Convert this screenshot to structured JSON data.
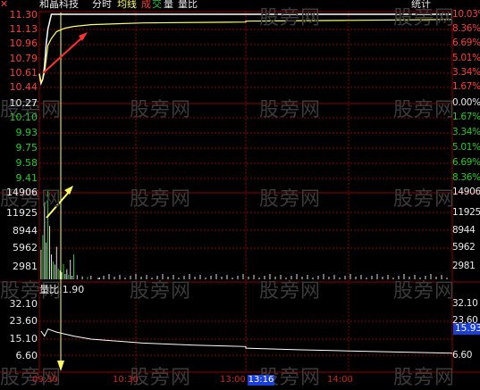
{
  "header": {
    "stock_name": "和晶科技",
    "tab_minute": "分时",
    "legend_avg": "均线",
    "legend_red": "成",
    "legend_green": "交",
    "legend_volume": "量",
    "legend_vol_ratio": "量比",
    "stats_button": "统计"
  },
  "price_axis": {
    "left_labels": [
      "11.30",
      "11.13",
      "10.96",
      "10.79",
      "10.61",
      "10.44",
      "10.27",
      "10.10",
      "9.93",
      "9.75",
      "9.58",
      "9.41"
    ],
    "right_labels": [
      "10.03%",
      "8.36%",
      "6.69%",
      "5.01%",
      "3.34%",
      "1.67%",
      "0.00%",
      "1.67%",
      "3.34%",
      "5.01%",
      "6.69%",
      "8.36%"
    ],
    "prev_close": 10.27,
    "range": [
      9.41,
      11.3
    ]
  },
  "volume_axis": {
    "left_labels": [
      "14906",
      "11925",
      "8944",
      "5962",
      "2981"
    ],
    "right_labels": [
      "14906",
      "11925",
      "8944",
      "5962",
      "2981"
    ]
  },
  "vol_ratio_panel": {
    "title": "量比:1.90",
    "left_labels": [
      "32.10",
      "23.60",
      "15.10",
      "6.60"
    ],
    "right_labels": [
      "32.10",
      "23.60",
      "",
      "6.60"
    ],
    "current_badge": "15.93"
  },
  "time_axis": {
    "labels": [
      "09:30",
      "10:30",
      "13:00",
      "14:00"
    ],
    "cursor": "13:16"
  },
  "watermark": "股旁网",
  "colors": {
    "up": "#ff3c3c",
    "down": "#22cc22",
    "grid": "#8b0000",
    "price_line": "#ffffff",
    "avg_line": "#ffff66",
    "volume": "#dddddd",
    "cursor": "#1a3fd8"
  },
  "chart_data": {
    "type": "line",
    "price_series": {
      "x": [
        "09:30",
        "09:31",
        "09:32",
        "09:33",
        "09:34",
        "09:35",
        "09:37",
        "09:40",
        "09:45",
        "09:50",
        "10:00",
        "10:30",
        "11:30",
        "13:00",
        "14:00",
        "15:00"
      ],
      "values": [
        10.61,
        10.5,
        10.55,
        10.7,
        10.96,
        11.13,
        11.3,
        11.3,
        11.3,
        11.3,
        11.3,
        11.3,
        11.3,
        11.3,
        11.3,
        11.3
      ]
    },
    "avg_series": {
      "x": [
        "09:30",
        "09:31",
        "09:32",
        "09:33",
        "09:34",
        "09:35",
        "09:37",
        "09:40",
        "09:45",
        "09:50",
        "10:00",
        "10:30",
        "11:30",
        "13:00",
        "14:00",
        "15:00"
      ],
      "values": [
        10.61,
        10.52,
        10.55,
        10.63,
        10.78,
        10.94,
        11.02,
        11.1,
        11.14,
        11.16,
        11.18,
        11.2,
        11.21,
        11.22,
        11.23,
        11.24
      ]
    },
    "volume_series": {
      "x_index": [
        1,
        2,
        3,
        4,
        5,
        6,
        7,
        8,
        9,
        10,
        11,
        12,
        13,
        14,
        15,
        16,
        17,
        18,
        19,
        20,
        22,
        25,
        28,
        30,
        35
      ],
      "values": [
        5000,
        7500,
        13000,
        6200,
        14906,
        9000,
        4200,
        3000,
        2500,
        5500,
        1800,
        1500,
        1200,
        2600,
        900,
        1700,
        800,
        3300,
        600,
        4200,
        700,
        500,
        400,
        600,
        300
      ]
    },
    "vol_ratio_series": {
      "x": [
        "09:31",
        "09:33",
        "09:35",
        "09:40",
        "09:50",
        "10:00",
        "10:30",
        "11:00",
        "11:30",
        "13:00",
        "13:30",
        "14:00",
        "14:30",
        "15:00"
      ],
      "values": [
        16.5,
        14.0,
        17.5,
        16.0,
        14.0,
        12.5,
        10.5,
        9.5,
        8.8,
        8.0,
        7.2,
        6.6,
        6.0,
        5.5
      ]
    }
  }
}
